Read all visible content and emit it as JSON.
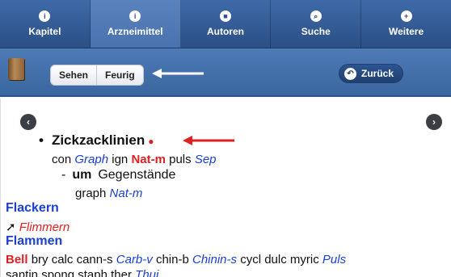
{
  "tabs": [
    {
      "label": "Kapitel",
      "icon": "info-icon",
      "glyph": "i"
    },
    {
      "label": "Arzneimittel",
      "icon": "medicine-icon",
      "glyph": "i"
    },
    {
      "label": "Autoren",
      "icon": "book-icon",
      "glyph": "■"
    },
    {
      "label": "Suche",
      "icon": "search-icon",
      "glyph": "⌕"
    },
    {
      "label": "Weitere",
      "icon": "plus-icon",
      "glyph": "+"
    }
  ],
  "toolbar": {
    "segments": [
      "Sehen",
      "Feurig"
    ],
    "back_label": "Zurück"
  },
  "entry": {
    "title": "Zickzacklinien",
    "remedies1": [
      {
        "text": "con",
        "style": "plain"
      },
      {
        "text": "Graph",
        "style": "italic"
      },
      {
        "text": "ign",
        "style": "plain"
      },
      {
        "text": "Nat-m",
        "style": "bold"
      },
      {
        "text": "puls",
        "style": "plain"
      },
      {
        "text": "Sep",
        "style": "italic"
      }
    ],
    "sub_prefix": "-",
    "sub_word": "um",
    "sub_text": "Gegenstände",
    "remedies2": [
      {
        "text": "graph",
        "style": "plain"
      },
      {
        "text": "Nat-m",
        "style": "italic"
      }
    ]
  },
  "headings": {
    "flackern": "Flackern",
    "flimmern": "Flimmern",
    "flammen": "Flammen"
  },
  "flammen_remedies_line1": [
    {
      "text": "Bell",
      "style": "bold"
    },
    {
      "text": "bry",
      "style": "plain"
    },
    {
      "text": "calc",
      "style": "plain"
    },
    {
      "text": "cann-s",
      "style": "plain"
    },
    {
      "text": "Carb-v",
      "style": "italic"
    },
    {
      "text": "chin-b",
      "style": "plain"
    },
    {
      "text": "Chinin-s",
      "style": "italic"
    },
    {
      "text": "cycl",
      "style": "plain"
    },
    {
      "text": "dulc",
      "style": "plain"
    },
    {
      "text": "myric",
      "style": "plain"
    },
    {
      "text": "Puls",
      "style": "italic"
    }
  ],
  "flammen_remedies_line2": [
    {
      "text": "santin",
      "style": "plain"
    },
    {
      "text": "spong",
      "style": "plain"
    },
    {
      "text": "staph",
      "style": "plain"
    },
    {
      "text": "ther",
      "style": "plain"
    },
    {
      "text": "Thuj",
      "style": "italic"
    }
  ],
  "colors": {
    "tabbar": "#2b4f86",
    "remedy_blue": "#1a3fd1",
    "remedy_red": "#e02020"
  }
}
